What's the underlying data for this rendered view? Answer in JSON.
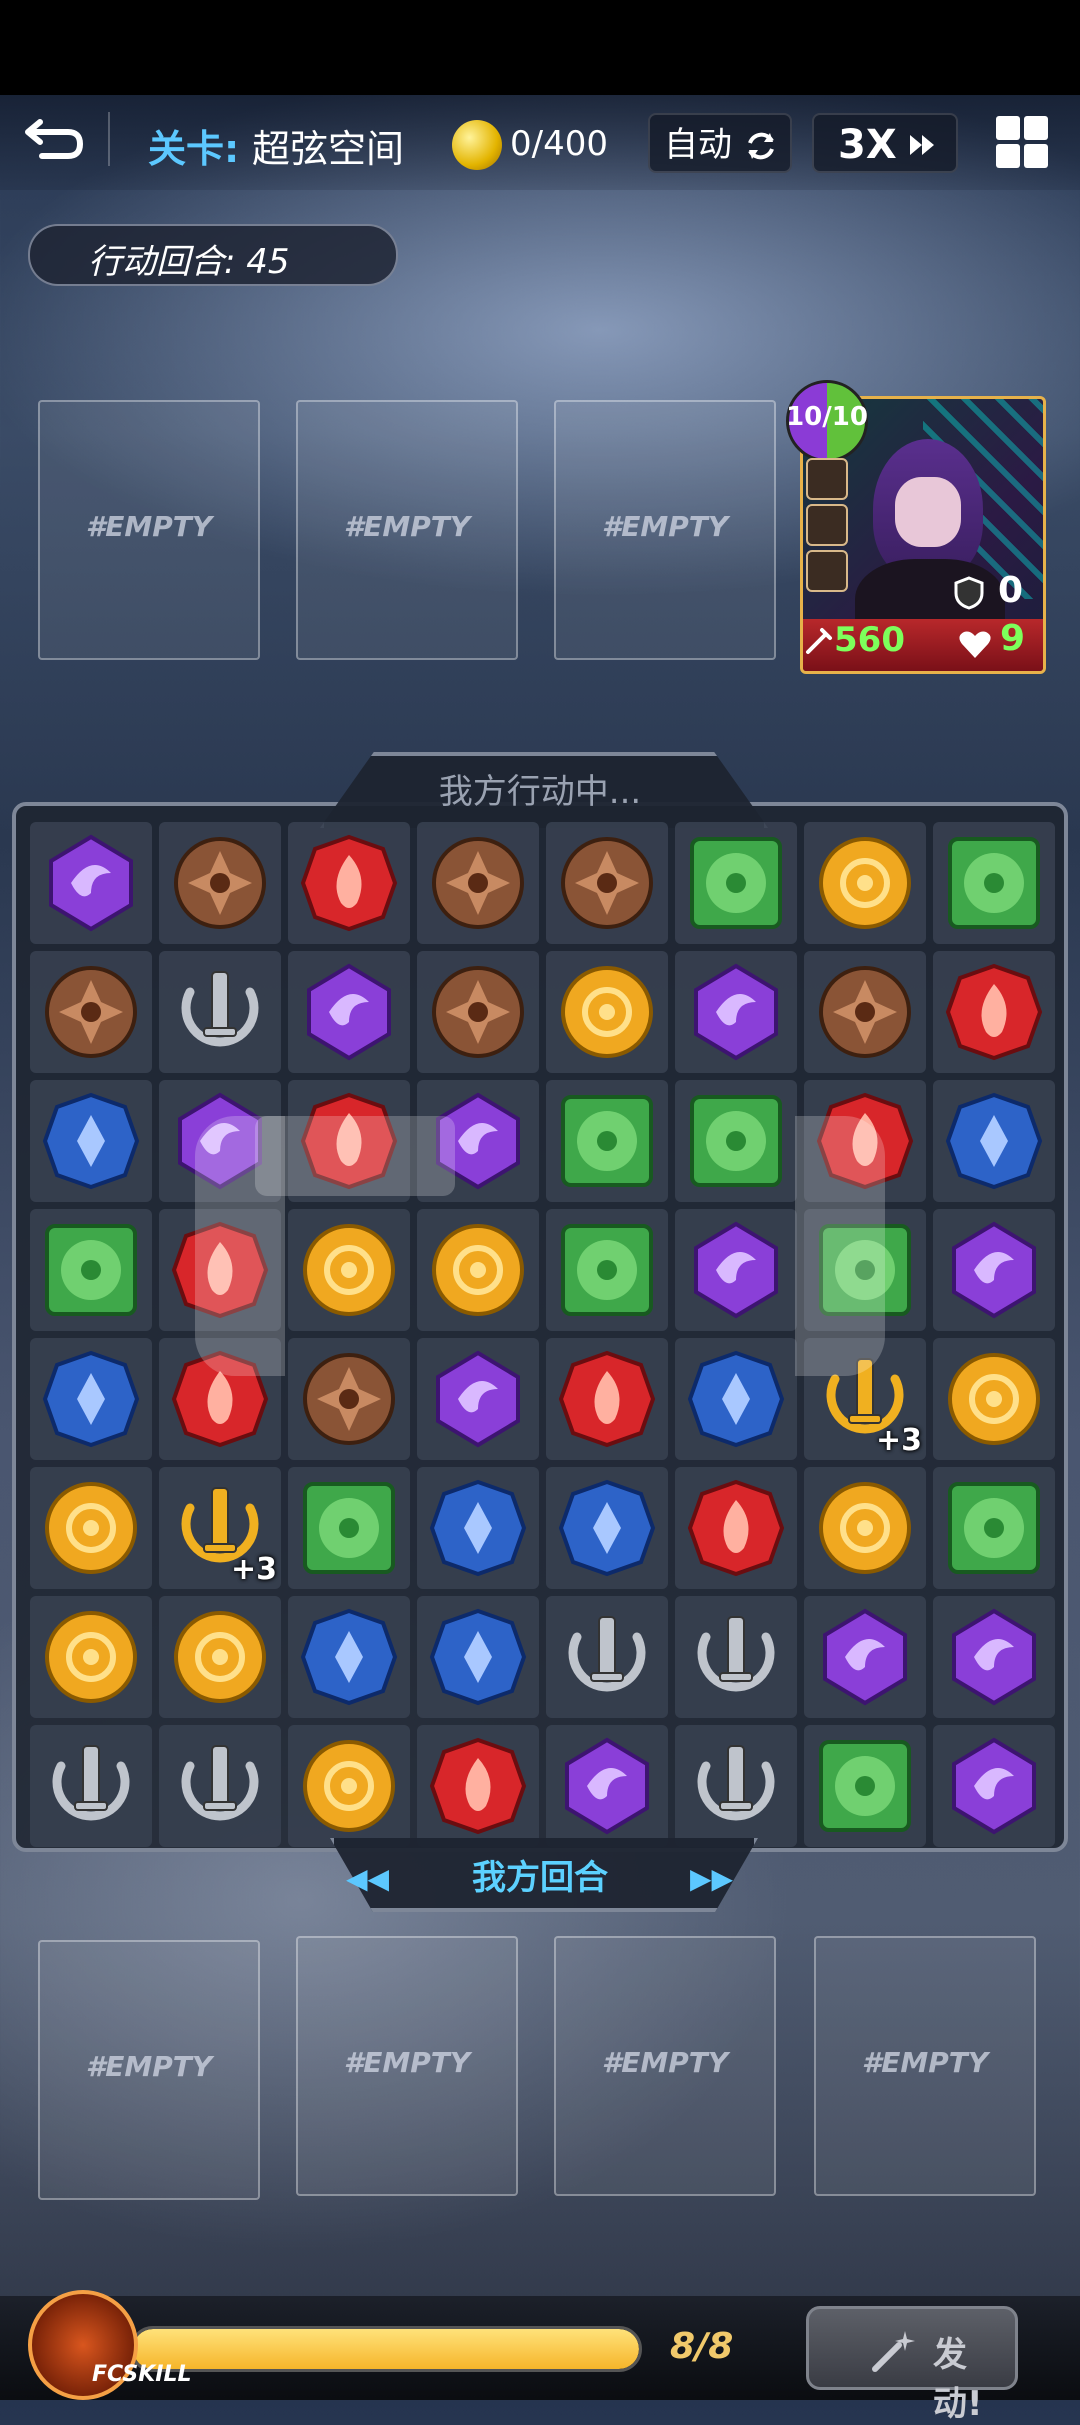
{
  "header": {
    "level_label": "关卡:",
    "level_name": "超弦空间",
    "coins": "0/400",
    "auto_label": "自动",
    "speed_label": "3X"
  },
  "turn_counter": "行动回合: 45",
  "enemy_slots": [
    "#EMPTY",
    "#EMPTY",
    "#EMPTY"
  ],
  "hero": {
    "hp_fraction": "10/10",
    "shield": "0",
    "attack": "560",
    "hp": "9"
  },
  "board": {
    "status": "我方行动中...",
    "round_label": "我方回合",
    "rows": [
      [
        "purple",
        "brown",
        "red",
        "brown",
        "brown",
        "green",
        "yellow",
        "green"
      ],
      [
        "brown",
        "silver",
        "purple",
        "brown",
        "yellow",
        "purple",
        "brown",
        "red"
      ],
      [
        "blue",
        "purple",
        "red",
        "purple",
        "green",
        "green",
        "red",
        "blue"
      ],
      [
        "green",
        "red",
        "yellow",
        "yellow",
        "green",
        "purple",
        "green",
        "purple"
      ],
      [
        "blue",
        "red",
        "brown",
        "purple",
        "red",
        "blue",
        "gold+3",
        "yellow"
      ],
      [
        "yellow",
        "gold+3",
        "green",
        "blue",
        "blue",
        "red",
        "yellow",
        "green"
      ],
      [
        "yellow",
        "yellow",
        "blue",
        "blue",
        "silver",
        "silver",
        "purple",
        "purple"
      ],
      [
        "silver",
        "silver",
        "yellow",
        "red",
        "purple",
        "silver",
        "green",
        "purple"
      ]
    ],
    "bonus_label": "+3"
  },
  "player_slots": [
    "#EMPTY",
    "#EMPTY",
    "#EMPTY",
    "#EMPTY"
  ],
  "skill_bar": {
    "label": "FCSKILL",
    "energy": "8/8",
    "energy_fraction": 1.0,
    "fire_label": "发动!"
  },
  "colors": {
    "purple": "#8a3fd8",
    "brown": "#8a5436",
    "red": "#d8262a",
    "green": "#3fa84a",
    "yellow": "#f0a820",
    "blue": "#2d63c8",
    "silver": "#bfc4cc",
    "gold": "#f0b020"
  }
}
